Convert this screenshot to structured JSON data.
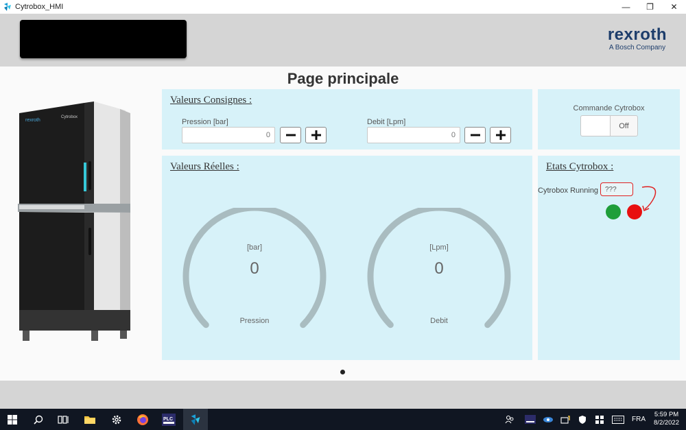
{
  "window": {
    "title": "Cytrobox_HMI",
    "controls": {
      "minimize": "—",
      "restore": "❐",
      "close": "✕"
    }
  },
  "header": {
    "brand_name": "rexroth",
    "brand_sub": "A Bosch Company"
  },
  "page_title": "Page principale",
  "consignes": {
    "title": "Valeurs Consignes :",
    "pression": {
      "label": "Pression  [bar]",
      "value": "0"
    },
    "debit": {
      "label": "Debit  [Lpm]",
      "value": "0"
    }
  },
  "commande": {
    "title": "Commande Cytrobox",
    "toggle_label": "Off"
  },
  "reelles": {
    "title": "Valeurs Réelles :",
    "gauges": [
      {
        "unit": "[bar]",
        "value": "0",
        "label": "Pression"
      },
      {
        "unit": "[Lpm]",
        "value": "0",
        "label": "Debit"
      }
    ]
  },
  "etats": {
    "title": "Etats Cytrobox :",
    "running_label": "Cytrobox Running :",
    "running_value": "???",
    "led_colors": [
      "#1f9e3a",
      "#e81010"
    ]
  },
  "colors": {
    "panel_bg": "#d7f2f9",
    "header_bg": "#d5d5d5",
    "brand": "#1d3d6b",
    "annotation": "#e02020",
    "gauge_track": "#a9bcc0"
  },
  "taskbar": {
    "icons": [
      "windows-start-icon",
      "search-icon",
      "task-view-icon",
      "file-explorer-icon",
      "settings-icon",
      "firefox-icon",
      "plc-app-icon",
      "cytrobox-app-icon"
    ],
    "language": "FRA",
    "time": "5:59 PM",
    "date": "8/2/2022"
  }
}
